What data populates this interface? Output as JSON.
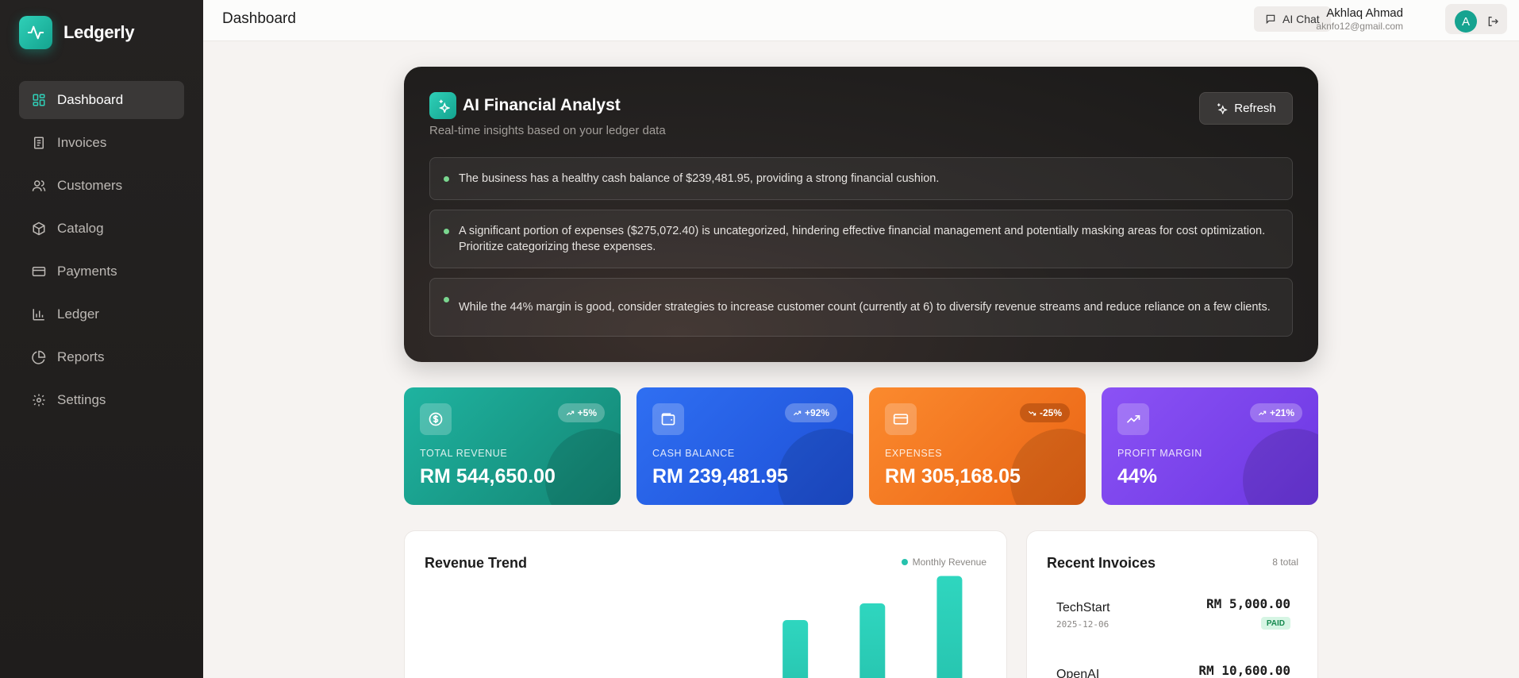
{
  "app": {
    "name": "Ledgerly"
  },
  "sidebar": {
    "items": [
      {
        "label": "Dashboard",
        "icon": "dashboard-icon",
        "active": true
      },
      {
        "label": "Invoices",
        "icon": "invoice-icon"
      },
      {
        "label": "Customers",
        "icon": "users-icon"
      },
      {
        "label": "Catalog",
        "icon": "package-icon"
      },
      {
        "label": "Payments",
        "icon": "credit-card-icon"
      },
      {
        "label": "Ledger",
        "icon": "bar-chart-icon"
      },
      {
        "label": "Reports",
        "icon": "pie-chart-icon"
      },
      {
        "label": "Settings",
        "icon": "gear-icon"
      }
    ]
  },
  "header": {
    "title": "Dashboard",
    "ai_chat_label": "AI Chat",
    "user_name": "Akhlaq Ahmad",
    "user_email": "aknfo12@gmail.com",
    "avatar_initial": "A"
  },
  "ai_panel": {
    "title": "AI Financial Analyst",
    "subtitle": "Real-time insights based on your ledger data",
    "refresh_label": "Refresh",
    "insights": [
      "The business has a healthy cash balance of $239,481.95, providing a strong financial cushion.",
      "A significant portion of expenses ($275,072.40) is uncategorized, hindering effective financial management and potentially masking areas for cost optimization. Prioritize categorizing these expenses.",
      "While the 44% margin is good, consider strategies to increase customer count (currently at 6) to diversify revenue streams and reduce reliance on a few clients."
    ]
  },
  "stats": [
    {
      "label": "TOTAL REVENUE",
      "value": "RM 544,650.00",
      "change": "+5%",
      "color": "#1fb3a0",
      "icon": "dollar-icon"
    },
    {
      "label": "CASH BALANCE",
      "value": "RM 239,481.95",
      "change": "+92%",
      "color": "#2f6ff2",
      "icon": "wallet-icon"
    },
    {
      "label": "EXPENSES",
      "value": "RM 305,168.05",
      "change": "-25%",
      "color": "#fb8a2e",
      "icon": "credit-card-icon"
    },
    {
      "label": "PROFIT MARGIN",
      "value": "44%",
      "change": "+21%",
      "color": "#8b52f5",
      "icon": "trending-up-icon"
    }
  ],
  "revenue_trend": {
    "title": "Revenue Trend",
    "legend": "Monthly Revenue"
  },
  "chart_data": {
    "type": "bar",
    "series": [
      {
        "name": "Monthly Revenue",
        "values": [
          0,
          0,
          0,
          0,
          62,
          76,
          99
        ]
      }
    ],
    "color": "#26c2ad"
  },
  "recent_invoices": {
    "title": "Recent Invoices",
    "total_label": "8 total",
    "items": [
      {
        "client": "TechStart",
        "date": "2025-12-06",
        "amount": "RM 5,000.00",
        "status": "PAID"
      },
      {
        "client": "OpenAI",
        "date": "",
        "amount": "RM 10,600.00",
        "status": ""
      }
    ]
  },
  "colors": {
    "accent": "#14a38f",
    "sidebar_bg": "#242221"
  }
}
